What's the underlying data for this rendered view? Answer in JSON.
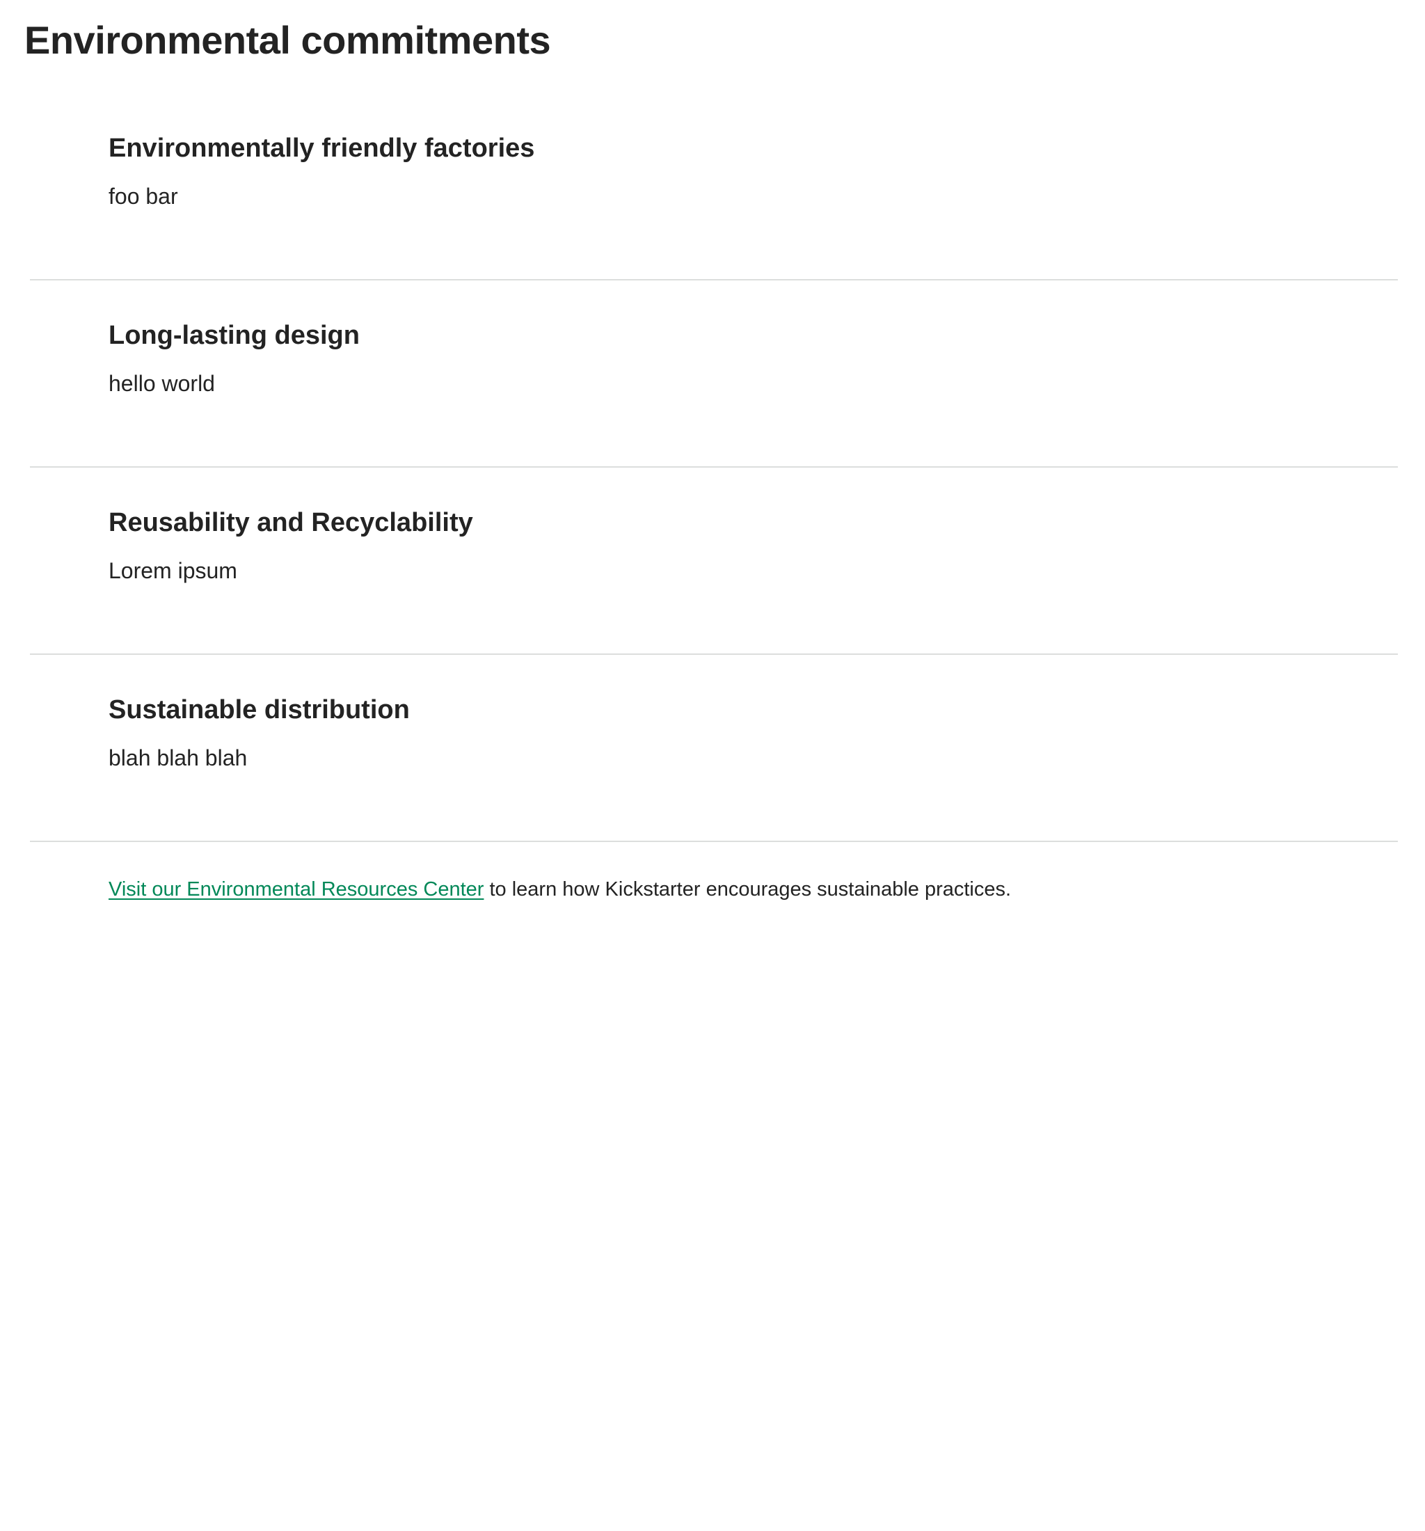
{
  "page": {
    "title": "Environmental commitments"
  },
  "commitments": [
    {
      "title": "Environmentally friendly factories",
      "text": "foo bar"
    },
    {
      "title": "Long-lasting design",
      "text": "hello world"
    },
    {
      "title": "Reusability and Recyclability",
      "text": "Lorem ipsum"
    },
    {
      "title": "Sustainable distribution",
      "text": "blah blah blah"
    }
  ],
  "resources": {
    "link_text": "Visit our Environmental Resources Center",
    "trailing_text": " to learn how Kickstarter encourages sustainable practices."
  },
  "colors": {
    "text": "#232323",
    "link": "#028858",
    "divider": "#dcdedd",
    "background": "#ffffff"
  }
}
